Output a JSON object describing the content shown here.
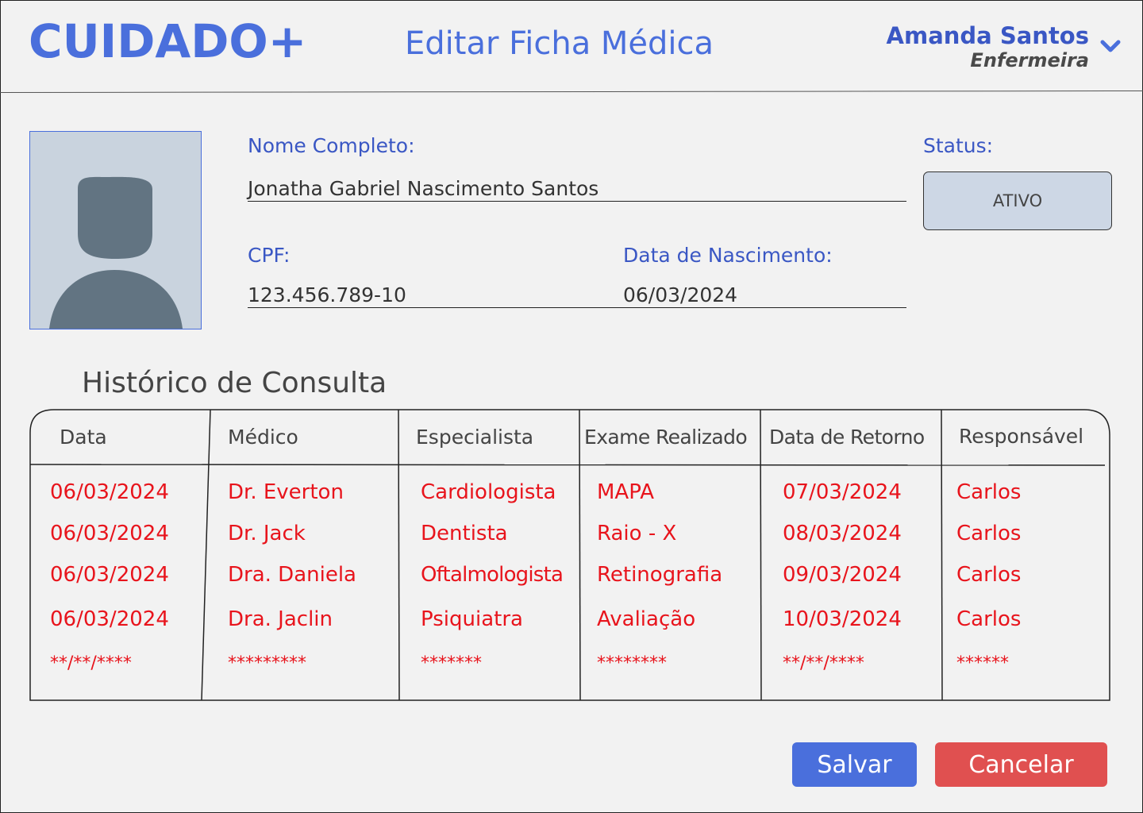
{
  "app": {
    "logo": "CUIDADO+",
    "page_title": "Editar Ficha Médica"
  },
  "user": {
    "name": "Amanda Santos",
    "role": "Enfermeira"
  },
  "patient": {
    "name_label": "Nome Completo:",
    "name_value": "Jonatha Gabriel Nascimento Santos",
    "cpf_label": "CPF:",
    "cpf_value": "123.456.789-10",
    "birth_label": "Data de Nascimento:",
    "birth_value": "06/03/2024",
    "status_label": "Status:",
    "status_value": "ATIVO"
  },
  "history": {
    "title": "Histórico de Consulta",
    "columns": [
      "Data",
      "Médico",
      "Especialista",
      "Exame Realizado",
      "Data de Retorno",
      "Responsável"
    ],
    "rows": [
      [
        "06/03/2024",
        "Dr. Everton",
        "Cardiologista",
        "MAPA",
        "07/03/2024",
        "Carlos"
      ],
      [
        "06/03/2024",
        "Dr. Jack",
        "Dentista",
        "Raio - X",
        "08/03/2024",
        "Carlos"
      ],
      [
        "06/03/2024",
        "Dra. Daniela",
        "Oftalmologista",
        "Retinografia",
        "09/03/2024",
        "Carlos"
      ],
      [
        "06/03/2024",
        "Dra. Jaclin",
        "Psiquiatra",
        "Avaliação",
        "10/03/2024",
        "Carlos"
      ],
      [
        "**/**/****",
        "*********",
        "*******",
        "********",
        "**/**/****",
        "******"
      ]
    ]
  },
  "actions": {
    "save_label": "Salvar",
    "cancel_label": "Cancelar"
  },
  "colors": {
    "accent": "#4a6fdc",
    "danger": "#e05050",
    "table_text": "#e8141c",
    "status_bg": "#cdd7e5"
  }
}
